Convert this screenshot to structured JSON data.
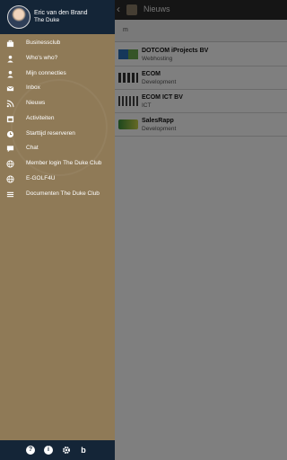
{
  "app": {
    "title": "Nieuws",
    "filter_text": "m",
    "companies": [
      {
        "name": "DOTCOM iProjects BV",
        "sector": "Webhosting"
      },
      {
        "name": "ECOM",
        "sector": "Development"
      },
      {
        "name": "ECOM ICT BV",
        "sector": "ICT"
      },
      {
        "name": "SalesRapp",
        "sector": "Development"
      }
    ]
  },
  "drawer": {
    "user_name": "Eric van den Brand",
    "club": "The Duke",
    "menu": [
      {
        "label": "Businessclub",
        "icon": "briefcase-icon"
      },
      {
        "label": "Who's who?",
        "icon": "person-icon"
      },
      {
        "label": "Mijn connecties",
        "icon": "person-icon"
      },
      {
        "label": "Inbox",
        "icon": "envelope-icon"
      },
      {
        "label": "Nieuws",
        "icon": "rss-icon"
      },
      {
        "label": "Activiteiten",
        "icon": "calendar-icon"
      },
      {
        "label": "Starttijd reserveren",
        "icon": "clock-icon"
      },
      {
        "label": "Chat",
        "icon": "chat-icon"
      },
      {
        "label": "Member login The Duke Club",
        "icon": "globe-icon"
      },
      {
        "label": "E-GOLF4U",
        "icon": "globe-icon"
      },
      {
        "label": "Documenten The Duke Club",
        "icon": "list-icon"
      }
    ],
    "footer_icons": [
      "help-icon",
      "info-icon",
      "settings-icon",
      "brand-b-icon"
    ]
  },
  "colors": {
    "drawer_bg": "#8f7a57",
    "header_bg": "#142537",
    "text": "#ffffff"
  }
}
